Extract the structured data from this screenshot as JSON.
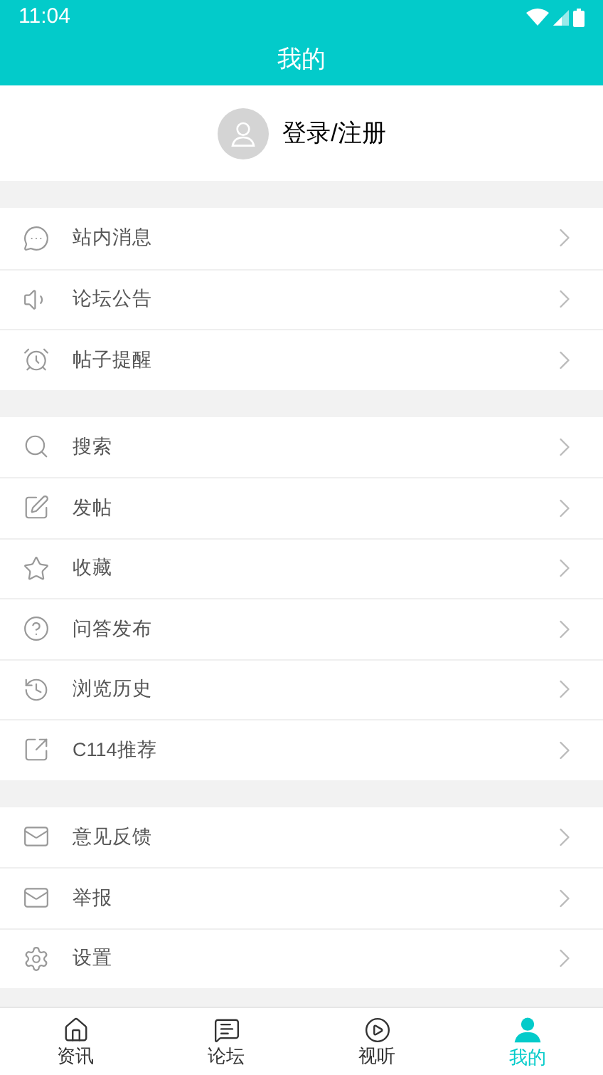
{
  "status_bar": {
    "time": "11:04"
  },
  "header": {
    "title": "我的"
  },
  "account": {
    "label": "登录/注册"
  },
  "menu_groups": [
    {
      "items": [
        {
          "label": "站内消息"
        },
        {
          "label": "论坛公告"
        },
        {
          "label": "帖子提醒"
        }
      ]
    },
    {
      "items": [
        {
          "label": "搜索"
        },
        {
          "label": "发帖"
        },
        {
          "label": "收藏"
        },
        {
          "label": "问答发布"
        },
        {
          "label": "浏览历史"
        },
        {
          "label": "C114推荐"
        }
      ]
    },
    {
      "items": [
        {
          "label": "意见反馈"
        },
        {
          "label": "举报"
        },
        {
          "label": "设置"
        }
      ]
    }
  ],
  "tab_bar": [
    {
      "label": "资讯",
      "selected": false
    },
    {
      "label": "论坛",
      "selected": false
    },
    {
      "label": "视听",
      "selected": false
    },
    {
      "label": "我的",
      "selected": true
    }
  ]
}
